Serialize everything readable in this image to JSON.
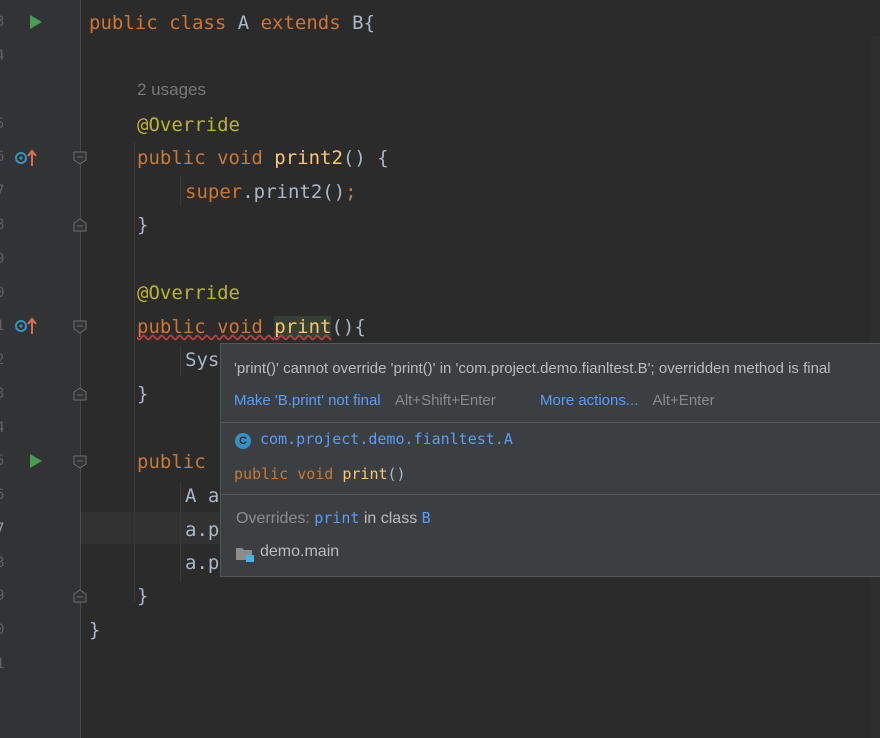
{
  "gutter": {
    "line_numbers": [
      "3",
      "4",
      "5",
      "6",
      "7",
      "8",
      "9",
      "0",
      "1",
      "2",
      "3",
      "4",
      "5",
      "6",
      "7",
      "8",
      "9",
      "0",
      "1"
    ]
  },
  "code": {
    "line1": {
      "kw1": "public ",
      "kw2": "class ",
      "name": "A ",
      "kw3": "extends ",
      "rest": "B{"
    },
    "usages": "2 usages",
    "line_ann1": "@Override",
    "line_print2": {
      "kw1": "public ",
      "kw2": "void ",
      "fn": "print2",
      "rest": "() {"
    },
    "line_super": {
      "kw": "super",
      "rest": ".print2()",
      "semi": ";"
    },
    "close1": "}",
    "line_ann2": "@Override",
    "line_print": {
      "kw1": "public ",
      "kw2": "void ",
      "fn": "print",
      "rest": "(){"
    },
    "line_sys": "Sys",
    "close2": "}",
    "line_main": "public",
    "line_aa": "A a",
    "line_ap1": "a.p",
    "line_ap2": "a.p",
    "close3": "}",
    "close4": "}"
  },
  "popup": {
    "message": "'print()' cannot override 'print()' in 'com.project.demo.fianltest.B'; overridden method is final",
    "fix_label": "Make 'B.print' not final",
    "fix_shortcut": "Alt+Shift+Enter",
    "more_label": "More actions...",
    "more_shortcut": "Alt+Enter",
    "class_badge": "C",
    "class_fqn": "com.project.demo.fianltest.A",
    "sig_kw1": "public ",
    "sig_kw2": "void ",
    "sig_fn": "print",
    "sig_rest": "()",
    "overrides_prefix": "Overrides: ",
    "overrides_method": "print",
    "overrides_mid": " in class ",
    "overrides_class": "B",
    "module": "demo.main"
  },
  "colors": {
    "background": "#2b2b2b",
    "keyword": "#cc7832",
    "annotation": "#bbb529",
    "function": "#ffc66d",
    "link": "#589df6",
    "run_icon": "#499c54",
    "error_underline": "#bc3f3c"
  },
  "icons": [
    "run-icon",
    "override-icon",
    "fold-icon",
    "class-icon",
    "module-folder-icon"
  ]
}
